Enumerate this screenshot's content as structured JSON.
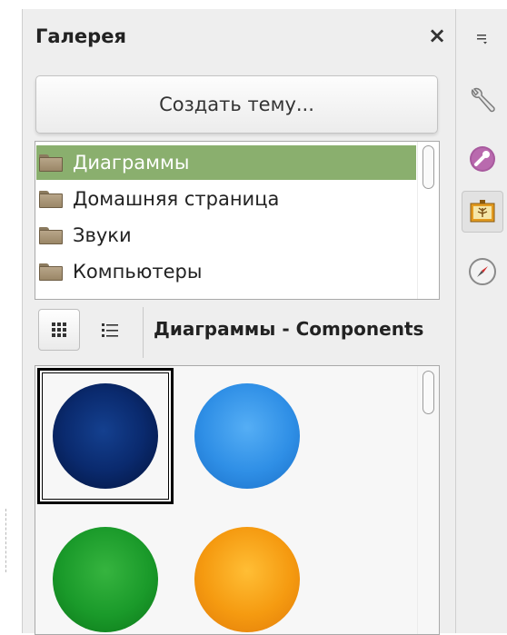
{
  "panel": {
    "title": "Галерея",
    "close_glyph": "×",
    "create_button_label": "Создать тему...",
    "themes": [
      {
        "label": "Диаграммы",
        "icon": "folder-icon",
        "selected": true
      },
      {
        "label": "Домашняя страница",
        "icon": "folder-icon",
        "selected": false
      },
      {
        "label": "Звуки",
        "icon": "folder-icon",
        "selected": false
      },
      {
        "label": "Компьютеры",
        "icon": "folder-icon",
        "selected": false
      }
    ],
    "view_modes": [
      {
        "name": "icon-view",
        "icon": "grid-icon",
        "active": true
      },
      {
        "name": "detail-view",
        "icon": "list-icon",
        "active": false
      }
    ],
    "current_theme_title": "Диаграммы - Components",
    "items": [
      {
        "name": "dark-blue-sphere",
        "color": "#0a2a6e",
        "selected": true
      },
      {
        "name": "blue-sphere",
        "color": "#2f8fe6",
        "selected": false
      },
      {
        "name": "green-sphere",
        "color": "#1a9a2a",
        "selected": false
      },
      {
        "name": "orange-sphere",
        "color": "#f59a10",
        "selected": false
      }
    ]
  },
  "sidebar": {
    "buttons": [
      {
        "name": "sidebar-menu-button",
        "icon": "hamburger-menu-icon",
        "active": false
      },
      {
        "name": "properties-button",
        "icon": "wrench-icon",
        "active": false
      },
      {
        "name": "styles-button",
        "icon": "styles-icon",
        "active": false
      },
      {
        "name": "gallery-button",
        "icon": "gallery-icon",
        "active": true
      },
      {
        "name": "navigator-button",
        "icon": "compass-icon",
        "active": false
      }
    ]
  },
  "colors": {
    "selection_green": "#8aaf6e",
    "panel_bg": "#eeeeee"
  }
}
